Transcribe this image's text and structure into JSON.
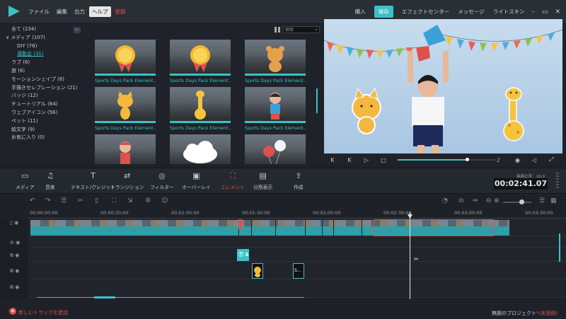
{
  "menu": {
    "items": [
      "ファイル",
      "編集",
      "出力",
      "ヘルプ",
      "登録"
    ],
    "active_index": 3,
    "right": [
      "購入",
      "保存",
      "エフェクトセンター",
      "メッセージ",
      "ライトスキン"
    ]
  },
  "window_buttons": [
    "–",
    "▭",
    "✕"
  ],
  "library": {
    "categories": [
      {
        "label": "全て (234)",
        "level": 0
      },
      {
        "label": "メディア (107)",
        "level": 0,
        "expanded": true
      },
      {
        "label": "DIY (76)",
        "level": 1
      },
      {
        "label": "運動会 (31)",
        "level": 1,
        "selected": true
      },
      {
        "label": "ラブ (6)",
        "level": 0
      },
      {
        "label": "旅 (6)",
        "level": 0
      },
      {
        "label": "モーションシェイプ (6)",
        "level": 0
      },
      {
        "label": "手描きセレブレーション (21)",
        "level": 0
      },
      {
        "label": "バッジ (12)",
        "level": 0
      },
      {
        "label": "チュートリアル (64)",
        "level": 0
      },
      {
        "label": "ウェブアイコン (56)",
        "level": 0
      },
      {
        "label": "ペット (11)",
        "level": 0
      },
      {
        "label": "絵文字 (9)",
        "level": 0
      },
      {
        "label": "お気に入り (0)",
        "level": 0
      }
    ],
    "search_placeholder": "検索",
    "items": [
      {
        "caption": "Sports Days Pack Element...",
        "art": "medal"
      },
      {
        "caption": "Sports Days Pack Element...",
        "art": "medal"
      },
      {
        "caption": "Sports Days Pack Element...",
        "art": "bear"
      },
      {
        "caption": "Sports Days Pack Element...",
        "art": "cat"
      },
      {
        "caption": "Sports Days Pack Element...",
        "art": "giraffe"
      },
      {
        "caption": "Sports Days Pack Element...",
        "art": "boy"
      },
      {
        "caption": "",
        "art": "runner"
      },
      {
        "caption": "",
        "art": "cloud"
      },
      {
        "caption": "",
        "art": "balloons"
      }
    ]
  },
  "preview": {
    "controls": [
      "K",
      "K",
      "▷",
      "□"
    ],
    "progress": 0.7
  },
  "toolbar": {
    "tools": [
      {
        "label": "メディア",
        "icon": "folder-icon",
        "glyph": "▭"
      },
      {
        "label": "音楽",
        "icon": "music-icon",
        "glyph": "♫"
      },
      {
        "label": "テキスト/クレジット",
        "icon": "text-icon",
        "glyph": "T"
      },
      {
        "label": "トランジション",
        "icon": "transition-icon",
        "glyph": "⇄"
      },
      {
        "label": "フィルター",
        "icon": "filter-icon",
        "glyph": "◎"
      },
      {
        "label": "オーバーレイ",
        "icon": "overlay-icon",
        "glyph": "▣"
      },
      {
        "label": "エレメント",
        "icon": "element-icon",
        "glyph": "⛶",
        "active": true
      },
      {
        "label": "分割表示",
        "icon": "split-icon",
        "glyph": "▤"
      },
      {
        "label": "作成",
        "icon": "export-icon",
        "glyph": "⇪"
      }
    ],
    "ratio": "画面比率：16:9",
    "timecode": "00:02:41.07"
  },
  "timeline": {
    "ruler_labels": [
      "00:00:00:00",
      "00:00:30:00",
      "00:01:00:00",
      "00:01:30:00",
      "00:02:00:00",
      "00:02:30:00",
      "00:03:00:00",
      "00:03:30:00"
    ],
    "title_clip_label": "Ⓣ S",
    "element_clip_label": "S...",
    "tools": [
      "↶",
      "↷",
      "☰",
      "✂",
      "▯",
      "⛶",
      "⇲",
      "⚙",
      "☺"
    ]
  },
  "status": {
    "add_track": "新しいトラックを追加",
    "project_name": "無題のプロジェクト",
    "unregistered": "*(未登録)"
  },
  "colors": {
    "accent": "#3bc1c9",
    "alert": "#e0504d",
    "background": "#1e2228"
  }
}
